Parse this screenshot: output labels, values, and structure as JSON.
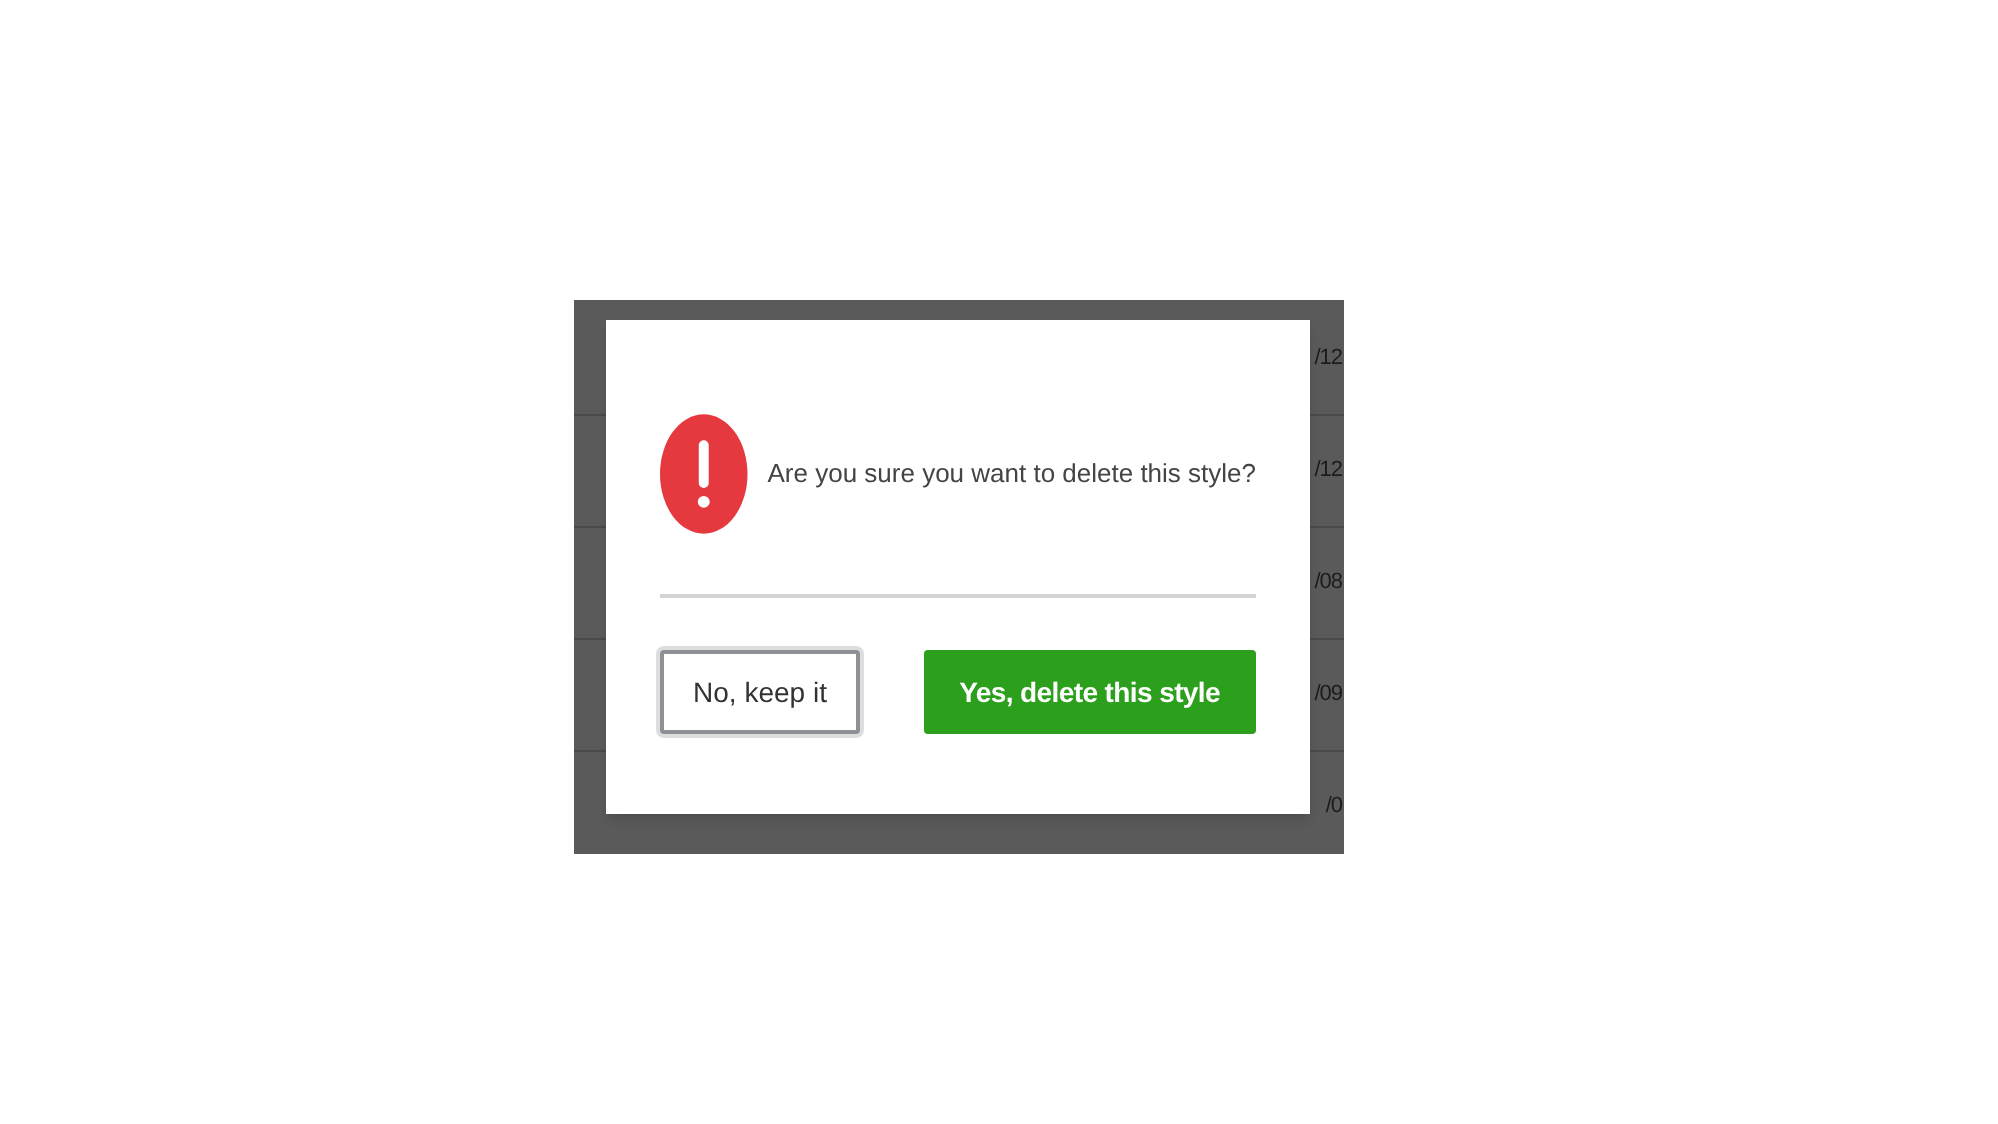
{
  "background_rows": [
    {
      "date": "/12"
    },
    {
      "date": "/12"
    },
    {
      "date": "/08"
    },
    {
      "date": "/09"
    },
    {
      "date": "/0"
    }
  ],
  "dialog": {
    "message": "Are you sure you want to delete this style?",
    "buttons": [
      {
        "label": "No, keep it",
        "kind": "secondary"
      },
      {
        "label": "Yes, delete this style",
        "kind": "primary"
      }
    ]
  }
}
